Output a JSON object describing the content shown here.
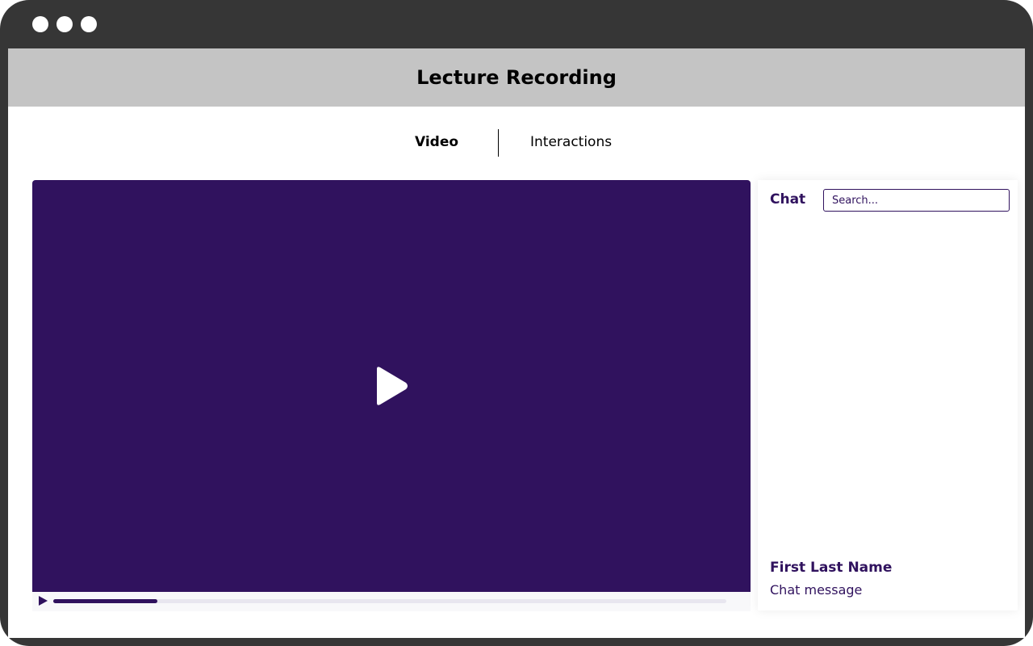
{
  "window": {
    "title": "Lecture Recording"
  },
  "tabs": [
    {
      "label": "Video",
      "active": true
    },
    {
      "label": "Interactions",
      "active": false
    }
  ],
  "video": {
    "progress_percent": 15.5,
    "background": "#30125e",
    "play_icon": "play-icon"
  },
  "chat": {
    "title": "Chat",
    "search_placeholder": "Search...",
    "messages": [
      {
        "name": "First Last Name",
        "text": "Chat message"
      }
    ]
  },
  "colors": {
    "accent": "#30125e",
    "header": "#c4c4c4",
    "frame": "#363636"
  }
}
